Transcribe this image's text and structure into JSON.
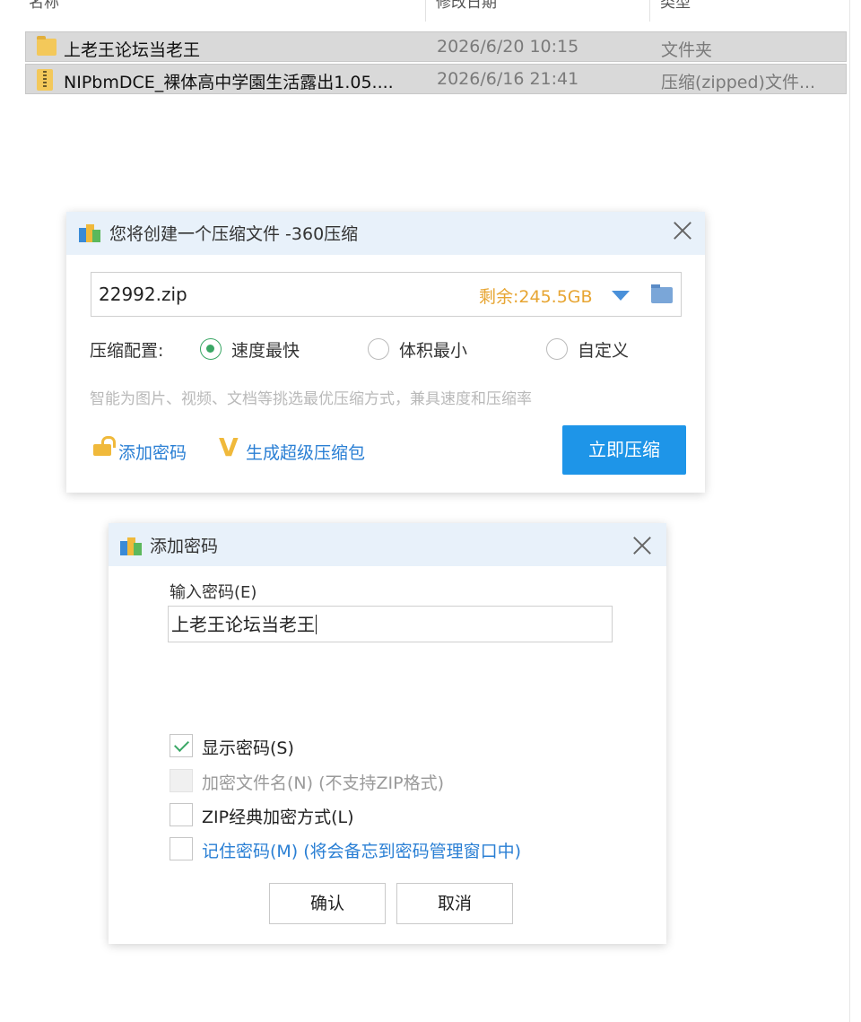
{
  "explorer": {
    "columns": [
      "名称",
      "修改日期",
      "类型"
    ],
    "rows": [
      {
        "name": "上老王论坛当老王",
        "date": "2026/6/20 10:15",
        "type": "文件夹",
        "icon": "folder-icon"
      },
      {
        "name": "NIPbmDCE_裸体高中学園生活露出1.05....",
        "date": "2026/6/16 21:41",
        "type": "压缩(zipped)文件...",
        "icon": "zip-icon"
      }
    ]
  },
  "compress_dialog": {
    "title": "您将创建一个压缩文件 -360压缩",
    "filename": "22992.zip",
    "free_space": "剩余:245.5GB",
    "config_label": "压缩配置:",
    "options": [
      {
        "label": "速度最快",
        "selected": true
      },
      {
        "label": "体积最小",
        "selected": false
      },
      {
        "label": "自定义",
        "selected": false
      }
    ],
    "hint": "智能为图片、视频、文档等挑选最优压缩方式，兼具速度和压缩率",
    "add_password": "添加密码",
    "super_package": "生成超级压缩包",
    "compress_button": "立即压缩",
    "colors": {
      "accent": "#1e95e8",
      "free_space": "#e7a532",
      "radio": "#3aa765"
    }
  },
  "password_dialog": {
    "title": "添加密码",
    "input_label": "输入密码(E)",
    "input_value": "上老王论坛当老王",
    "options": [
      {
        "label": "显示密码(S)",
        "checked": true,
        "enabled": true
      },
      {
        "label": "加密文件名(N) (不支持ZIP格式)",
        "checked": false,
        "enabled": false
      },
      {
        "label": "ZIP经典加密方式(L)",
        "checked": false,
        "enabled": true
      },
      {
        "label": "记住密码(M) (将会备忘到密码管理窗口中)",
        "checked": false,
        "enabled": true
      }
    ],
    "confirm_button": "确认",
    "cancel_button": "取消"
  }
}
